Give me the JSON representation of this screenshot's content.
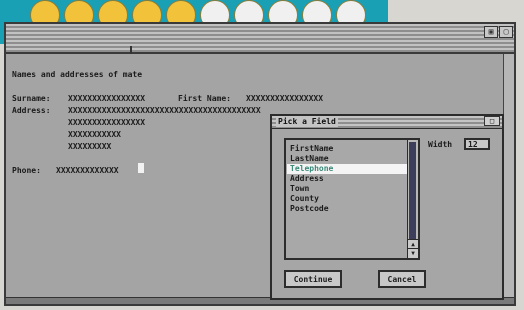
{
  "colors": {
    "strip": "#1aa0b4",
    "dots": [
      "#f2c23a",
      "#f2c23a",
      "#f2c23a",
      "#f2c23a",
      "#f2c23a",
      "#f0f0f0",
      "#f0f0f0",
      "#f0f0f0",
      "#f0f0f0",
      "#f0f0f0"
    ]
  },
  "form": {
    "heading": "Names and addresses of mate",
    "surname_label": "Surname:",
    "surname_value": "XXXXXXXXXXXXXXXX",
    "firstname_label": "First Name:",
    "firstname_value": "XXXXXXXXXXXXXXXX",
    "address_label": "Address:",
    "address_line1": "XXXXXXXXXXXXXXXXXXXXXXXXXXXXXXXXXXXXXXXX",
    "address_line2": "XXXXXXXXXXXXXXXX",
    "address_line3": "XXXXXXXXXXX",
    "address_line4": "XXXXXXXXX",
    "phone_label": "Phone:",
    "phone_value": "XXXXXXXXXXXXX"
  },
  "dialog": {
    "title": "Pick a Field",
    "close_glyph": "□",
    "fields": [
      "FirstName",
      "LastName",
      "Telephone",
      "Address",
      "Town",
      "County",
      "Postcode"
    ],
    "selected": "Telephone",
    "width_label": "Width",
    "width_value": "12",
    "continue_label": "Continue",
    "cancel_label": "Cancel"
  }
}
